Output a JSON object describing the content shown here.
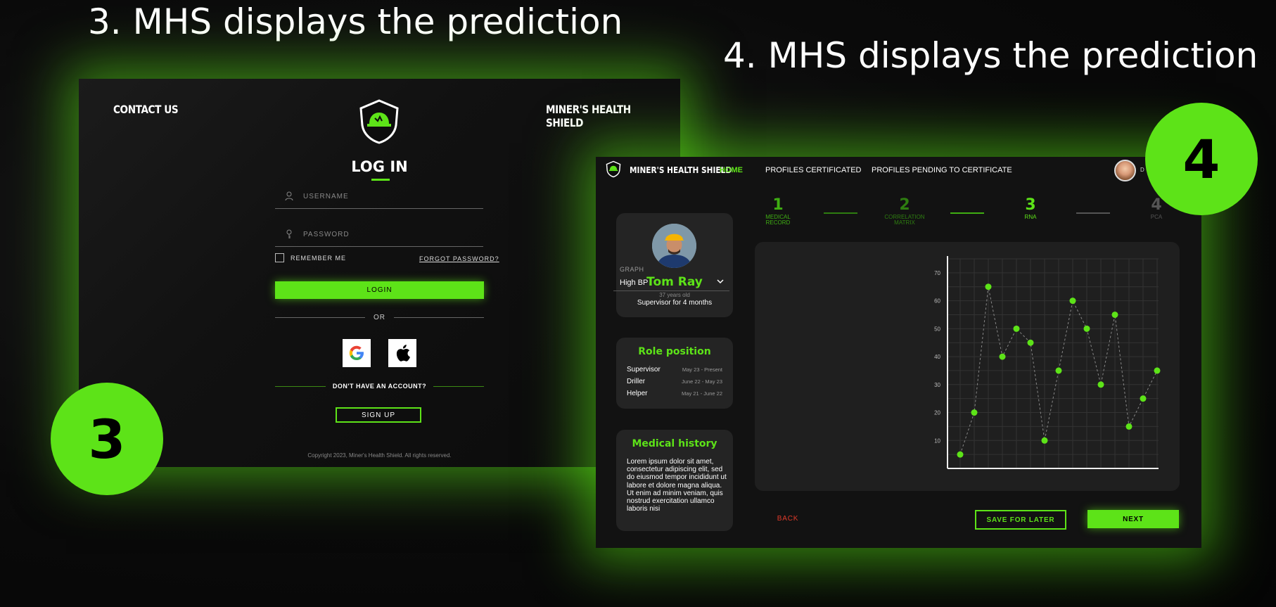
{
  "headings": {
    "left": "3. MHS displays the prediction",
    "right": "4. MHS displays the prediction"
  },
  "badges": {
    "left": "3",
    "right": "4"
  },
  "login": {
    "contact": "CONTACT US",
    "brand": "MINER'S HEALTH SHIELD",
    "title": "LOG IN",
    "username_placeholder": "USERNAME",
    "password_placeholder": "PASSWORD",
    "remember": "REMEMBER ME",
    "forgot": "FORGOT PASSWORD?",
    "login_button": "LOGIN",
    "or": "OR",
    "no_account": "DON'T HAVE AN ACCOUNT?",
    "signup": "SIGN UP",
    "copyright": "Copyright 2023, Miner's Health Shield. All rights reserved."
  },
  "dashboard": {
    "brand": "MINER'S HEALTH SHIELD",
    "nav": {
      "home": "HOME",
      "certificated": "PROFILES CERTIFICATED",
      "pending": "PROFILES PENDING TO CERTIFICATE"
    },
    "avatar_name": "D",
    "steps": [
      {
        "num": "1",
        "label": "MEDICAL RECORD"
      },
      {
        "num": "2",
        "label": "CORRELATION MATRIX"
      },
      {
        "num": "3",
        "label": "RNA"
      },
      {
        "num": "4",
        "label": "PCA"
      }
    ],
    "profile": {
      "name": "Tom Ray",
      "age": "37 years old",
      "role": "Supervisor for 4 months"
    },
    "role_position": {
      "title": "Role position",
      "rows": [
        {
          "role": "Supervisor",
          "dates": "May 23 - Present"
        },
        {
          "role": "Driller",
          "dates": "June 22 - May 23"
        },
        {
          "role": "Helper",
          "dates": "May 21 - June 22"
        }
      ]
    },
    "medical_history": {
      "title": "Medical history",
      "text": "Lorem ipsum dolor sit amet, consectetur adipiscing elit, sed do eiusmod tempor incididunt ut labore et dolore magna aliqua. Ut enim ad minim veniam, quis nostrud exercitation ullamco laboris nisi"
    },
    "graph": {
      "label": "GRAPH",
      "value": "High BP"
    },
    "buttons": {
      "back": "BACK",
      "save": "SAVE FOR LATER",
      "next": "NEXT"
    },
    "colors": {
      "accent": "#5de318",
      "back": "#e03a2a"
    }
  },
  "chart_data": {
    "type": "line",
    "title": "",
    "xlabel": "",
    "ylabel": "",
    "yticks": [
      10,
      20,
      30,
      40,
      50,
      60,
      70
    ],
    "ylim": [
      0,
      75
    ],
    "grid": true,
    "x": [
      1,
      2,
      3,
      4,
      5,
      6,
      7,
      8,
      9,
      10,
      11,
      12,
      13,
      14,
      15,
      16
    ],
    "series": [
      {
        "values": [
          5,
          20,
          65,
          40,
          50,
          45,
          10,
          35,
          60,
          50,
          30,
          55,
          15,
          25,
          35
        ]
      }
    ]
  }
}
